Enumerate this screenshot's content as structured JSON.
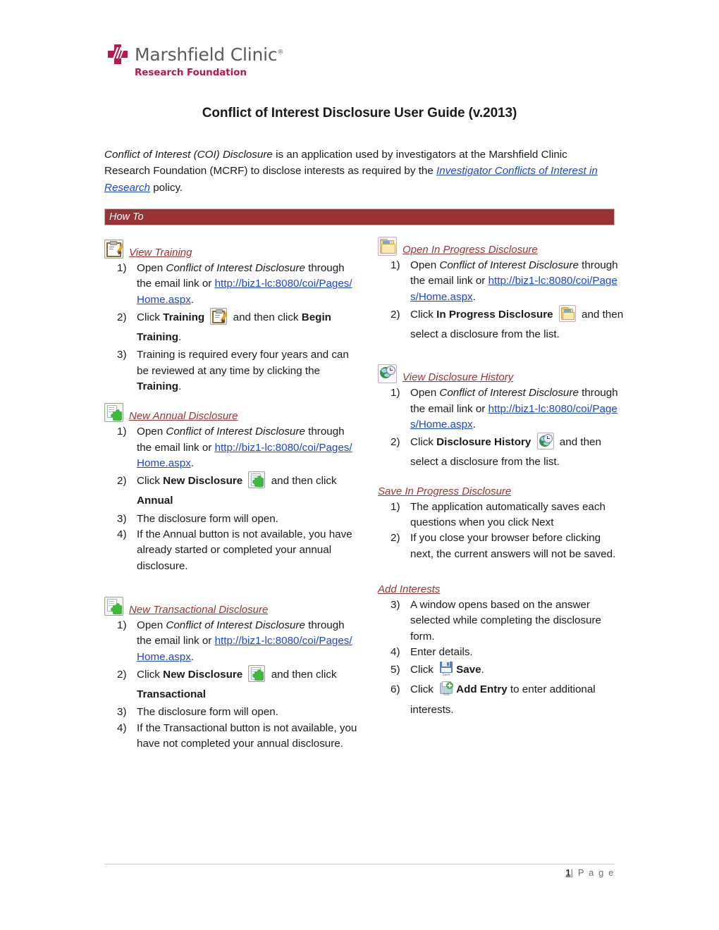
{
  "logo": {
    "name": "Marshfield Clinic",
    "registered": "®",
    "subtitle": "Research Foundation",
    "mark_color": "#b5174f",
    "word_color": "#5b5b5f"
  },
  "document": {
    "title": "Conflict of Interest Disclosure User Guide (v.2013)",
    "intro": {
      "lead_italic": "Conflict of Interest (COI) Disclosure",
      "text_1": " is an application used by investigators at the Marshfield Clinic Research Foundation (MCRF) to disclose interests as required by the ",
      "link_text": "Investigator Conflicts of Interest in Research",
      "text_2": " policy."
    },
    "banner": {
      "label": "How To",
      "bg_color": "#993333",
      "text_color": "#ffffff"
    },
    "footer": {
      "page_number": "1",
      "separator": "|",
      "page_label": "P a g e"
    }
  },
  "common": {
    "open_text": "Open ",
    "app_italic": "Conflict of Interest Disclosure",
    "through_email": " through the email link or ",
    "url": "http://biz1-lc:8080/coi/Pages/Home.aspx",
    "period": "."
  },
  "sections": {
    "view_training": {
      "title": "View Training",
      "icon": "clipboard-pencil-icon",
      "step2_pre": "Click ",
      "step2_bold": "Training",
      "step2_mid": " and then click ",
      "step2_bold2": "Begin Training",
      "step2_end": ".",
      "step3": "Training is required every four years and can be reviewed at any time by clicking the ",
      "step3_bold": "Training",
      "step3_end": "."
    },
    "new_annual": {
      "title": "New Annual Disclosure",
      "icon": "document-green-puzzle-icon",
      "step2_pre": "Click ",
      "step2_bold": "New Disclosure",
      "step2_mid": " and then click ",
      "step2_bold2": "Annual",
      "step3": "The disclosure form will open.",
      "step4": "If the Annual button is not available, you have already started or completed your annual disclosure."
    },
    "new_transactional": {
      "title": "New Transactional Disclosure",
      "icon": "document-green-puzzle-icon",
      "step2_pre": "Click ",
      "step2_bold": "New Disclosure",
      "step2_mid": " and then click ",
      "step2_bold2": "Transactional",
      "step3": "The disclosure form will open.",
      "step4": "If the Transactional button is not available, you have not completed your annual disclosure."
    },
    "open_in_progress": {
      "title": "Open In Progress Disclosure",
      "icon": "open-folder-icon",
      "step2_pre": "Click ",
      "step2_bold": "In Progress Disclosure",
      "step2_end": " and then select a disclosure from the list."
    },
    "view_history": {
      "title": "View Disclosure History",
      "icon": "globe-clock-icon",
      "step2_pre": "Click ",
      "step2_bold": "Disclosure History",
      "step2_end": " and then select a disclosure from the list."
    },
    "save_in_progress": {
      "title": "Save In Progress Disclosure",
      "step1": "The application automatically saves each questions when you click Next",
      "step2": "If you close your browser before clicking next, the current answers will not be saved."
    },
    "add_interests": {
      "title": "Add Interests",
      "step3": "A window opens based on the answer selected while completing the disclosure form.",
      "step4": "Enter details.",
      "step5_pre": "Click ",
      "step5_bold": "Save",
      "step5_end": ".",
      "step6_pre": "Click ",
      "step6_bold": "Add Entry",
      "step6_end": " to enter additional interests.",
      "save_icon": "floppy-disk-save-icon",
      "add_icon": "add-entry-icon"
    }
  }
}
